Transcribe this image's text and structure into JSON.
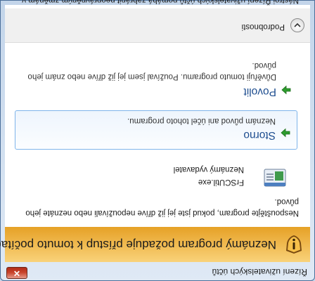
{
  "window": {
    "title": "Řízení uživatelských účtů",
    "close_glyph": "✕"
  },
  "banner": {
    "title": "Neznámý program požaduje přístup k tomuto počítači."
  },
  "content": {
    "description": "Nespouštějte program, pokud jste jej již dříve nepoužívali nebo neznáte jeho původ.",
    "program": {
      "name": "FrSCUtil.exe",
      "publisher": "Neznámý vydavatel"
    },
    "cancel": {
      "title": "Storno",
      "description": "Neznám původ ani účel tohoto programu."
    },
    "allow": {
      "title": "Povolit",
      "description": "Důvěřuji tomuto programu. Používal jsem jej již dříve nebo znám jeho původ."
    },
    "details": {
      "label": "Podrobnosti"
    },
    "footer": "Nástroj Řízení uživatelských účtů pomáhá zabránit neoprávněným změnám v počítači."
  },
  "colors": {
    "banner": "#e6a126",
    "link_title": "#1e4d8f",
    "arrow": "#2e9c2e"
  },
  "icons": {
    "banner": "shield-warning-icon",
    "program": "application-icon",
    "option_arrow": "green-arrow-icon",
    "details": "chevron-down-icon"
  }
}
